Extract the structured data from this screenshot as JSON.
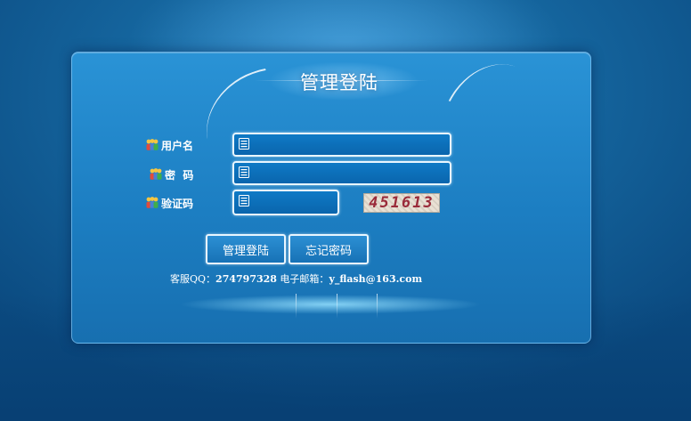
{
  "title": "管理登陆",
  "form": {
    "username_label": "用户名",
    "password_label": "密  码",
    "captcha_label": "验证码",
    "username_value": "",
    "password_value": "",
    "captcha_value": "",
    "captcha_image_text": "451613"
  },
  "buttons": {
    "login_label": "管理登陆",
    "forgot_label": "忘记密码"
  },
  "contact": {
    "qq_label": "客服QQ：",
    "qq_number": "274797328",
    "email_label": " 电子邮箱：",
    "email": "y_flash@163.com"
  },
  "icons": {
    "label_icon": "users-icon",
    "field_icon": "form-field-icon"
  },
  "colors": {
    "background": "#15669f",
    "panel": "#1c7ec2",
    "field_fill": "#0b6aaf",
    "field_border": "#e8f6ff",
    "captcha_text": "#9a2b3a"
  }
}
